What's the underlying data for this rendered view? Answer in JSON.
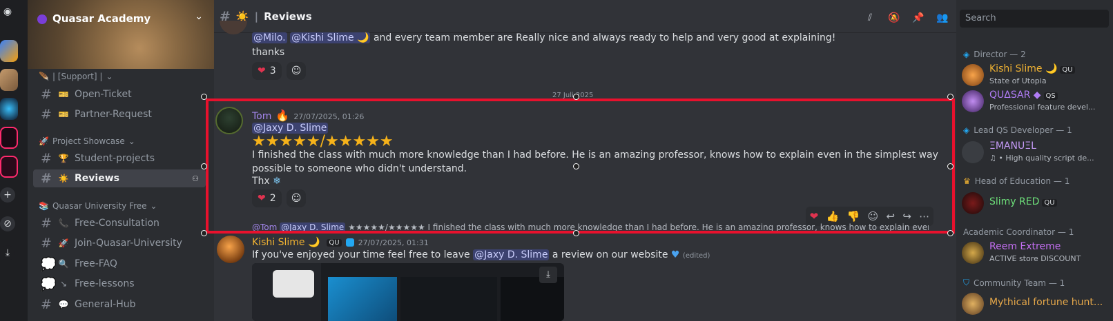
{
  "server": {
    "name": "Quasar Academy"
  },
  "channels": {
    "categories": [
      {
        "label": "| [Support] |"
      },
      {
        "label": "Project Showcase"
      },
      {
        "label": "Quasar University Free"
      }
    ],
    "items": [
      {
        "label": "Open-Ticket",
        "emoji": "🎫"
      },
      {
        "label": "Partner-Request",
        "emoji": "🎫"
      },
      {
        "label": "Student-projects",
        "emoji": "🏆"
      },
      {
        "label": "Reviews",
        "emoji": "☀️"
      },
      {
        "label": "Free-Consultation",
        "emoji": "📞"
      },
      {
        "label": "Join-Quasar-University",
        "emoji": "🚀"
      },
      {
        "label": "Free-FAQ",
        "emoji": "🔍"
      },
      {
        "label": "Free-lessons",
        "emoji": "↘"
      },
      {
        "label": "General-Hub",
        "emoji": "💬"
      }
    ]
  },
  "header": {
    "channel": "Reviews",
    "emoji": "☀️",
    "search_placeholder": "Search"
  },
  "messages": {
    "prev": {
      "mention1": "@Milo.",
      "mention2": "@Kishi Slime 🌙",
      "text": "and every team member are Really nice  and always ready to help and very good at explaining!",
      "line2": "thanks",
      "react_count": "3"
    },
    "date_divider": "27 Juli 2025",
    "tom": {
      "author": "Tom",
      "timestamp": "27/07/2025, 01:26",
      "mention": "@Jaxy D. Slime",
      "stars": "★★★★★/★★★★★",
      "text": "I finished the class with much more knowledge than I had before. He is an amazing professor, knows how to explain even in the simplest way possible to someone who didn't understand.",
      "line2": "Thx",
      "react_count": "2"
    },
    "reply_preview": {
      "author": "@Tom",
      "mention": "@Jaxy D. Slime",
      "text": "★★★★★/★★★★★ I finished the class with much more knowledge than I had before. He is an amazing professor, knows how to explain even in th"
    },
    "kishi": {
      "author": "Kishi Slime 🌙",
      "tag": "QU",
      "timestamp": "27/07/2025, 01:31",
      "text1": "If you've enjoyed your time feel free to leave",
      "mention": "@Jaxy D. Slime",
      "text2": "a review on our website",
      "edited": "(edited)"
    }
  },
  "members": {
    "roles": [
      {
        "label": "Director — 2"
      },
      {
        "label": "Lead QS Developer — 1"
      },
      {
        "label": "Head of Education — 1"
      },
      {
        "label": "Academic Coordinator — 1"
      },
      {
        "label": "Community Team — 1"
      }
    ],
    "list": [
      {
        "name": "Kishi Slime 🌙",
        "tag": "QU",
        "status": "State of Utopia",
        "color": "#f0b232"
      },
      {
        "name": "QUΔSAR ◆",
        "tag": "QS",
        "status": "Professional feature devel...",
        "color": "#b07cf5"
      },
      {
        "name": "ΞMANUΞL",
        "status": "♫ • High quality script de...",
        "color": "#c59af7"
      },
      {
        "name": "Slimy RED",
        "tag": "QU",
        "color": "#6ee07a"
      },
      {
        "name": "Reem Extreme",
        "status": "ACTIVE store DISCOUNT",
        "color": "#c46ff2"
      },
      {
        "name": "Mythical fortune hunt...",
        "color": "#e6a84a"
      }
    ]
  }
}
